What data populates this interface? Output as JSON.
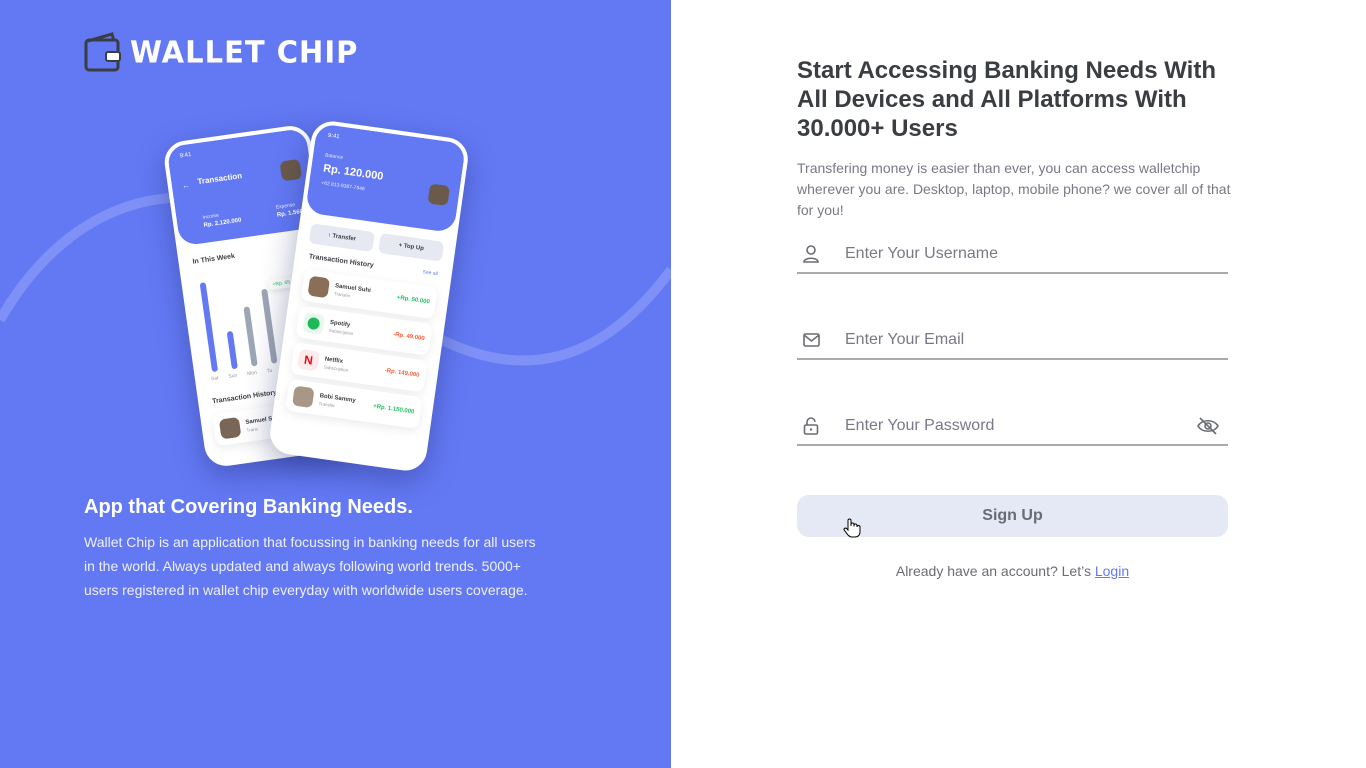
{
  "brand": {
    "name": "WALLET CHIP"
  },
  "promo": {
    "heading": "App that Covering Banking Needs.",
    "description": "Wallet Chip is an application that focussing in banking needs for all users in the world. Always updated and always following world trends. 5000+ users registered in wallet chip everyday with worldwide users coverage."
  },
  "mockup": {
    "back": {
      "time": "9:41",
      "title": "Transaction",
      "income_label": "Income",
      "income_value": "Rp. 2.120.000",
      "expense_label": "Expense",
      "expense_value": "Rp. 1.560",
      "week_title": "In This Week",
      "badge": "+Rp. 65.000",
      "days": [
        "Sat",
        "Sun",
        "Mon",
        "Tu"
      ],
      "history_title": "Transaction History",
      "tx_name": "Samuel S",
      "tx_sub": "Trans"
    },
    "front": {
      "time": "9:41",
      "balance_label": "Balance",
      "balance": "Rp. 120.000",
      "phone": "+62 813-9387-7946",
      "transfer": "Transfer",
      "topup": "Top Up",
      "history_title": "Transaction History",
      "see_all": "See all",
      "transactions": [
        {
          "name": "Samuel Suhi",
          "sub": "Transfer",
          "amount": "+Rp. 50.000"
        },
        {
          "name": "Spotify",
          "sub": "Subscription",
          "amount": "-Rp. 49.000"
        },
        {
          "name": "Netflix",
          "sub": "Subscription",
          "amount": "-Rp. 149.000"
        },
        {
          "name": "Bobi Sammy",
          "sub": "Transfer",
          "amount": "+Rp. 1.150.000"
        }
      ]
    }
  },
  "form": {
    "title": "Start Accessing Banking Needs With All Devices and All Platforms With 30.000+ Users",
    "subtitle": "Transfering money is easier than ever, you can access walletchip wherever you are. Desktop, laptop, mobile phone? we cover all of that for you!",
    "username_placeholder": "Enter Your Username",
    "email_placeholder": "Enter Your Email",
    "password_placeholder": "Enter Your Password",
    "signup_label": "Sign Up",
    "login_prompt": "Already have an account? Let’s ",
    "login_link": "Login"
  },
  "colors": {
    "primary": "#6379F4",
    "text": "#3A3D42",
    "button_bg": "#E5E8F5"
  }
}
